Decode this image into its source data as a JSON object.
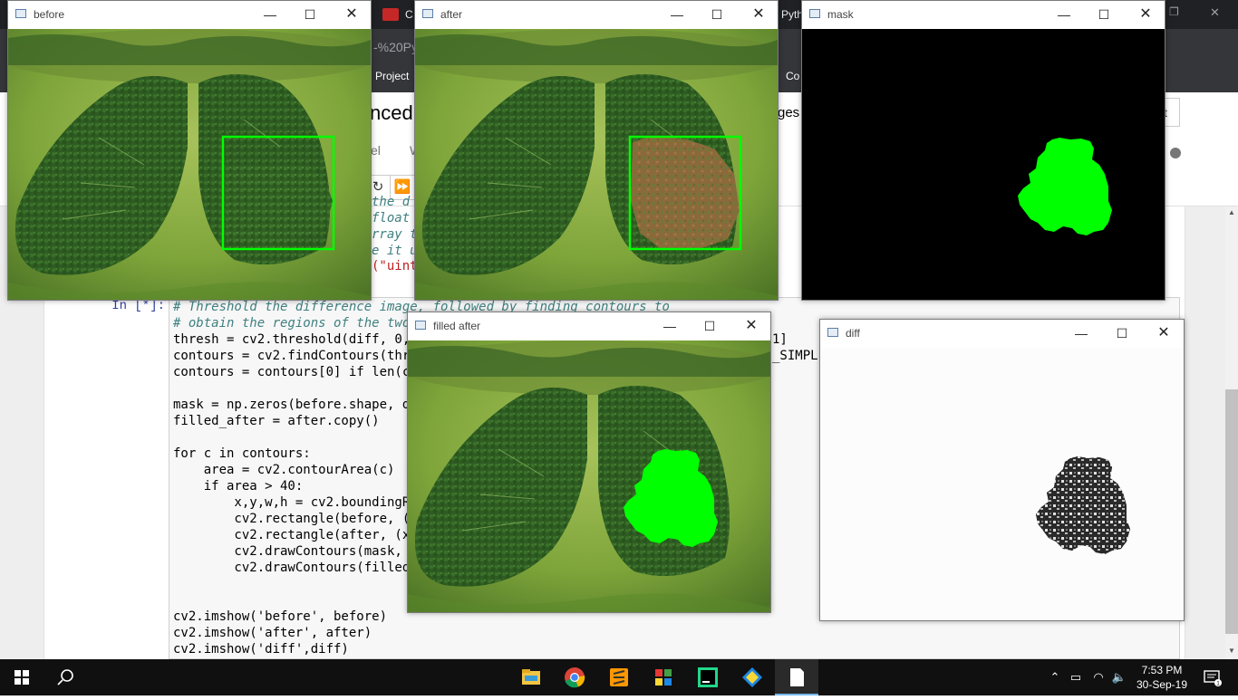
{
  "browser": {
    "tab_fragment_1": "C",
    "tab_fragment_2": "Pyth",
    "url_fragment": "-%20Py",
    "bookmark_project": "Project",
    "bookmark_co": "Co"
  },
  "notebook": {
    "title_fragment": "nced",
    "title_right_fragment": "ges",
    "kernel_button_fragment": "nt",
    "menu_kernel_fragment": "el",
    "menu_widgets_fragment": "W",
    "prompt": "In [*]:",
    "prev_cell_lines": [
      "the d",
      "float",
      "rray t",
      "e it u"
    ],
    "prev_cell_string": "(\"uint",
    "code_lines": [
      "# Threshold the difference image, followed by finding contours to",
      "# obtain the regions of the two",
      "thresh = cv2.threshold(diff, 0,",
      "contours = cv2.findContours(thr",
      "contours = contours[0] if len(c",
      "",
      "mask = np.zeros(before.shape, d",
      "filled_after = after.copy()",
      "",
      "for c in contours:",
      "    area = cv2.contourArea(c)",
      "    if area > 40:",
      "        x,y,w,h = cv2.boundingR",
      "        cv2.rectangle(before, (",
      "        cv2.rectangle(after, (x",
      "        cv2.drawContours(mask,",
      "        cv2.drawContours(filled",
      "",
      "",
      "cv2.imshow('before', before)",
      "cv2.imshow('after', after)",
      "cv2.imshow('diff',diff)"
    ],
    "code_right_fragment_1": "1]",
    "code_right_fragment_2": "_SIMPL"
  },
  "windows": {
    "before": {
      "title": "before"
    },
    "after": {
      "title": "after"
    },
    "mask": {
      "title": "mask"
    },
    "filled_after": {
      "title": "filled after"
    },
    "diff": {
      "title": "diff"
    }
  },
  "window_controls": {
    "minimize": "—",
    "maximize": "☐",
    "close": "✕"
  },
  "taskbar": {
    "apps": [
      "file-explorer",
      "chrome",
      "sublime-text",
      "app-grid",
      "pycharm",
      "git-tool",
      "notepad"
    ],
    "time": "7:53 PM",
    "date": "30-Sep-19"
  },
  "colors": {
    "highlight_green": "#00ff00",
    "jupyter_prompt": "#303f9f",
    "taskbar_bg": "#101010"
  }
}
